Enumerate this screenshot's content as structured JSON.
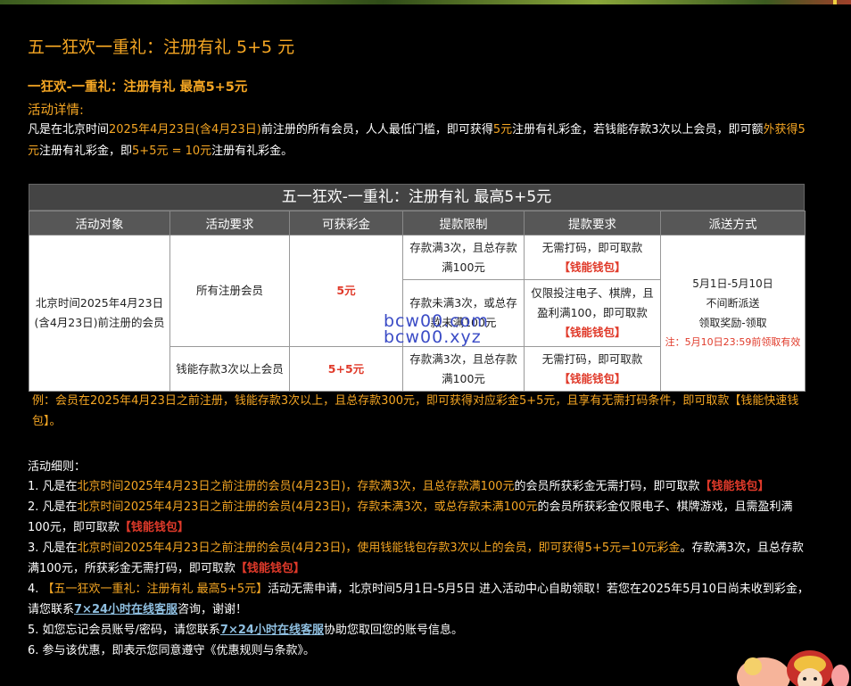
{
  "page_title": "五一狂欢一重礼：注册有礼 5+5 元",
  "sub_title": "一狂欢-一重礼：注册有礼 最高5+5元",
  "details_label": "活动详情:",
  "intro": {
    "p1": "凡是在北京时间",
    "date": "2025年4月23日(含4月23日)",
    "p2": "前注册的所有会员，人人最低门槛，即可获得",
    "amount": "5元",
    "p3": "注册有礼彩金，若钱能存款3次以上会员，即可额",
    "extra": "外获得5元",
    "p4": "注册有礼彩金，即",
    "total": "5+5元 = 10元",
    "p5": "注册有礼彩金。"
  },
  "table": {
    "title": "五一狂欢-一重礼：注册有礼 最高5+5元",
    "headers": [
      "活动对象",
      "活动要求",
      "可获彩金",
      "提款限制",
      "提款要求",
      "派送方式"
    ],
    "target": "北京时间2025年4月23日(含4月23日)前注册的会员",
    "req_all": "所有注册会员",
    "req_wallet": "钱能存款3次以上会员",
    "bonus_all": "5元",
    "bonus_wallet_num": "5+5",
    "bonus_wallet_unit": "元",
    "limit_1": "存款满3次，且总存款满100元",
    "limit_2": "存款未满3次，或总存款未满100元",
    "limit_3": "存款满3次，且总存款满100元",
    "withdraw_1": "无需打码，即可取款",
    "withdraw_1_wallet": "【钱能钱包】",
    "withdraw_2": "仅限投注电子、棋牌，且盈利满100，即可取款",
    "withdraw_2_wallet": "【钱能钱包】",
    "withdraw_3": "无需打码，即可取款",
    "withdraw_3_wallet": "【钱能钱包】",
    "sched_1": "5月1日-5月10日",
    "sched_2": "不间断派送",
    "sched_3": "领取奖励-领取",
    "sched_note": "注：5月10日23:59前领取有效"
  },
  "watermark": {
    "line1": "bcw00.com",
    "line2": "bcw00.xyz"
  },
  "example": "例：会员在2025年4月23日之前注册，钱能存款3次以上，且总存款300元，即可获得对应彩金5+5元，且享有无需打码条件，即可取款【钱能快速钱包】。",
  "rules_label": "活动细则：",
  "rules": {
    "r1_a": "1. 凡是在",
    "r1_b": "北京时间2025年4月23日之前注册的会员(4月23日)，存款满3次，且总存款满100元",
    "r1_c": "的会员所获彩金无需打码，即可取款",
    "r1_d": "【钱能钱包】",
    "r2_a": "2. 凡是在",
    "r2_b": "北京时间2025年4月23日之前注册的会员(4月23日)，存款未满3次，或总存款未满100元",
    "r2_c": "的会员所获彩金仅限电子、棋牌游戏，且需盈利满100元，即可取款",
    "r2_d": "【钱能钱包】",
    "r3_a": "3. 凡是在",
    "r3_b": "北京时间2025年4月23日之前注册的会员(4月23日)，使用钱能钱包存款3次以上的会员，即可获得5+5元=10元彩金",
    "r3_c": "。存款满3次，且总存款满100元，所获彩金无需打码，即可取款",
    "r3_d": "【钱能钱包】",
    "r4_a": "4. ",
    "r4_b": "【五一狂欢一重礼：注册有礼 最高5+5元】",
    "r4_c": "活动无需申请，北京时间5月1日-5月5日 进入活动中心自助领取！若您在2025年5月10日尚未收到彩金，请您联系",
    "r4_link": "7×24小时在线客服",
    "r4_d": "咨询，谢谢！",
    "r5_a": "5. 如您忘记会员账号/密码，请您联系",
    "r5_link": "7×24小时在线客服",
    "r5_b": "协助您取回您的账号信息。",
    "r6": "6. 参与该优惠，即表示您同意遵守《优惠规则与条款》。"
  },
  "colors": {
    "accent": "#f5a623",
    "red": "#e03a2a",
    "header_bg": "#575757"
  }
}
